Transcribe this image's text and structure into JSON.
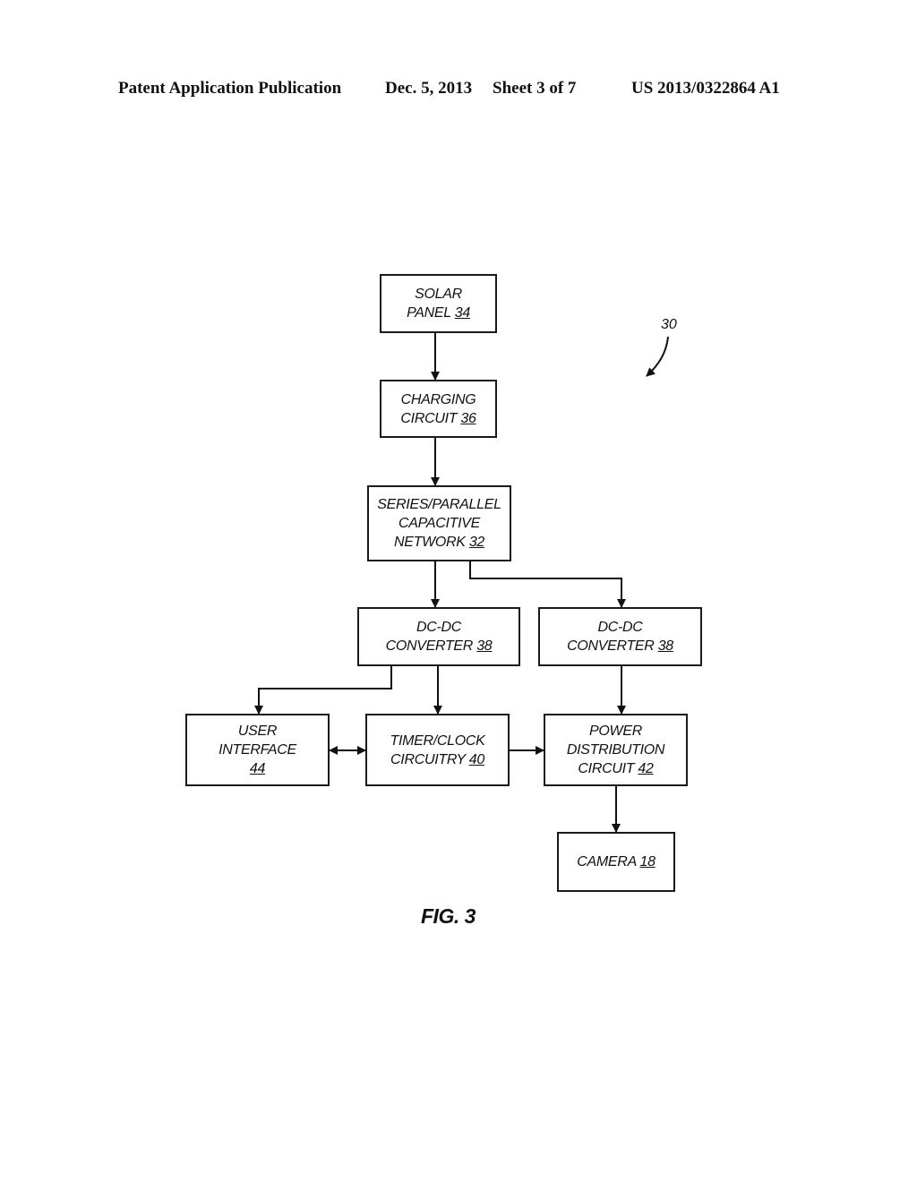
{
  "header": {
    "publication": "Patent Application Publication",
    "date": "Dec. 5, 2013",
    "sheet": "Sheet 3 of 7",
    "number": "US 2013/0322864 A1"
  },
  "diagram": {
    "reference_label": "30",
    "figure_label": "FIG. 3",
    "blocks": {
      "solar_panel": {
        "line1": "SOLAR",
        "line2": "PANEL",
        "ref": "34"
      },
      "charging_circuit": {
        "line1": "CHARGING",
        "line2": "CIRCUIT",
        "ref": "36"
      },
      "capacitive_network": {
        "line1": "SERIES/PARALLEL",
        "line2": "CAPACITIVE",
        "line3": "NETWORK",
        "ref": "32"
      },
      "dcdc_left": {
        "line1": "DC-DC",
        "line2": "CONVERTER",
        "ref": "38"
      },
      "dcdc_right": {
        "line1": "DC-DC",
        "line2": "CONVERTER",
        "ref": "38"
      },
      "user_interface": {
        "line1": "USER",
        "line2": "INTERFACE",
        "ref": "44"
      },
      "timer_clock": {
        "line1": "TIMER/CLOCK",
        "line2": "CIRCUITRY",
        "ref": "40"
      },
      "power_distribution": {
        "line1": "POWER",
        "line2": "DISTRIBUTION",
        "line3": "CIRCUIT",
        "ref": "42"
      },
      "camera": {
        "line1": "CAMERA",
        "ref": "18"
      }
    },
    "connections": [
      {
        "from": "solar_panel",
        "to": "charging_circuit",
        "type": "arrow"
      },
      {
        "from": "charging_circuit",
        "to": "capacitive_network",
        "type": "arrow"
      },
      {
        "from": "capacitive_network",
        "to": "dcdc_left",
        "type": "arrow"
      },
      {
        "from": "capacitive_network",
        "to": "dcdc_right",
        "type": "arrow"
      },
      {
        "from": "dcdc_left",
        "to": "user_interface",
        "type": "arrow"
      },
      {
        "from": "dcdc_left",
        "to": "timer_clock",
        "type": "arrow"
      },
      {
        "from": "dcdc_right",
        "to": "power_distribution",
        "type": "arrow"
      },
      {
        "from": "user_interface",
        "to": "timer_clock",
        "type": "bidirectional"
      },
      {
        "from": "timer_clock",
        "to": "power_distribution",
        "type": "arrow"
      },
      {
        "from": "power_distribution",
        "to": "camera",
        "type": "arrow"
      }
    ]
  }
}
